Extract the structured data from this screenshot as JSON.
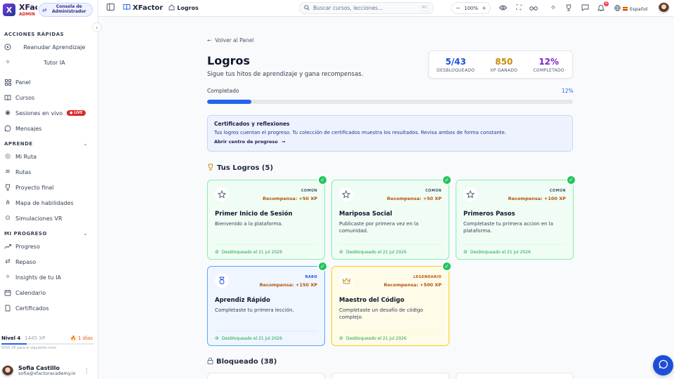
{
  "brand": {
    "logo_letter": "X",
    "name": "XFactor",
    "admin_badge": "ADMIN",
    "console_button": "Consola de Administrador"
  },
  "sidebar": {
    "quick_actions": {
      "title": "ACCIONES RÁPIDAS",
      "items": [
        {
          "label": "Reanudar Aprendizaje",
          "icon": "play-circle-icon"
        },
        {
          "label": "Tutor IA",
          "icon": "sparkles-icon"
        }
      ]
    },
    "main_items": [
      {
        "label": "Panel",
        "icon": "grid-icon"
      },
      {
        "label": "Cursos",
        "icon": "book-icon"
      },
      {
        "label": "Sesiones en vivo",
        "icon": "broadcast-icon",
        "badge": "LIVE"
      },
      {
        "label": "Mensajes",
        "icon": "chat-icon"
      }
    ],
    "learn": {
      "title": "APRENDE",
      "items": [
        {
          "label": "Mi Ruta",
          "icon": "target-icon"
        },
        {
          "label": "Rutas",
          "icon": "layers-icon"
        },
        {
          "label": "Proyecto final",
          "icon": "trophy-icon"
        },
        {
          "label": "Mapa de habilidades",
          "icon": "network-icon"
        },
        {
          "label": "Simulaciones VR",
          "icon": "vr-icon"
        }
      ]
    },
    "progress": {
      "title": "MI PROGRESO",
      "items": [
        {
          "label": "Progreso",
          "icon": "trend-icon"
        },
        {
          "label": "Repaso",
          "icon": "repeat-icon"
        },
        {
          "label": "Insights de tu IA",
          "icon": "sparkles-icon"
        },
        {
          "label": "Calendario",
          "icon": "calendar-icon"
        },
        {
          "label": "Certificados",
          "icon": "certificate-icon"
        }
      ]
    },
    "level": {
      "label": "Nivel 4",
      "xp": "1445 XP",
      "streak": "1 días",
      "next": "5555 XP para el siguiente nivel",
      "progress": 0.27
    },
    "user": {
      "name": "Sofia Castillo",
      "email": "sofia@xfactoracademy.io"
    }
  },
  "topbar": {
    "brand": "XFactor",
    "breadcrumb": "Logros",
    "search_placeholder": "Buscar cursos, lecciones...",
    "search_shortcut": "⌘K",
    "zoom": "100%",
    "notifications": "8",
    "language": "Español"
  },
  "page": {
    "back": "Volver al Panel",
    "title": "Logros",
    "subtitle": "Sigue tus hitos de aprendizaje y gana recompensas.",
    "stats": [
      {
        "value": "5/43",
        "label": "DESBLOQUEADO",
        "color": "#1d4ed8"
      },
      {
        "value": "850",
        "label": "XP GANADO",
        "color": "#ca8a04"
      },
      {
        "value": "12%",
        "label": "COMPLETADO",
        "color": "#7e22ce"
      }
    ],
    "progress": {
      "label": "Completado",
      "pct_text": "12%",
      "value": 12
    },
    "cert": {
      "title": "Certificados y reflexiones",
      "text": "Tus logros cuentan el progreso. Tu colección de certificados muestra los resultados. Revisa ambos de forma constante.",
      "link": "Abrir centro de progreso"
    },
    "unlocked_title": "Tus Logros (5)",
    "locked_title": "Bloqueado (38)",
    "achievements": [
      {
        "rarity": "COMÚN",
        "reward": "Recompensa: +50 XP",
        "name": "Primer Inicio de Sesión",
        "desc": "Bienvenido a la plataforma.",
        "date": "Desbloqueado el 21 jul 2026",
        "icon": "star-icon",
        "tier": "comun"
      },
      {
        "rarity": "COMÚN",
        "reward": "Recompensa: +50 XP",
        "name": "Mariposa Social",
        "desc": "Publicaste por primera vez en la comunidad.",
        "date": "Desbloqueado el 21 jul 2026",
        "icon": "star-icon",
        "tier": "comun"
      },
      {
        "rarity": "COMÚN",
        "reward": "Recompensa: +100 XP",
        "name": "Primeros Pasos",
        "desc": "Completaste tu primera accion en la plataforma.",
        "date": "Desbloqueado el 21 jul 2026",
        "icon": "star-icon",
        "tier": "comun"
      },
      {
        "rarity": "RARO",
        "reward": "Recompensa: +150 XP",
        "name": "Aprendiz Rápido",
        "desc": "Completaste tu primera lección.",
        "date": "Desbloqueado el 21 jul 2026",
        "icon": "medal-icon",
        "tier": "raro"
      },
      {
        "rarity": "LEGENDARIO",
        "reward": "Recompensa: +500 XP",
        "name": "Maestro del Código",
        "desc": "Completaste un desafío de código complejo.",
        "date": "Desbloqueado el 21 jul 2026",
        "icon": "crown-icon",
        "tier": "leg"
      }
    ]
  },
  "colors": {
    "accent": "#2563eb",
    "success": "#22c55e",
    "danger": "#dc2626",
    "reward": "#b45309"
  }
}
